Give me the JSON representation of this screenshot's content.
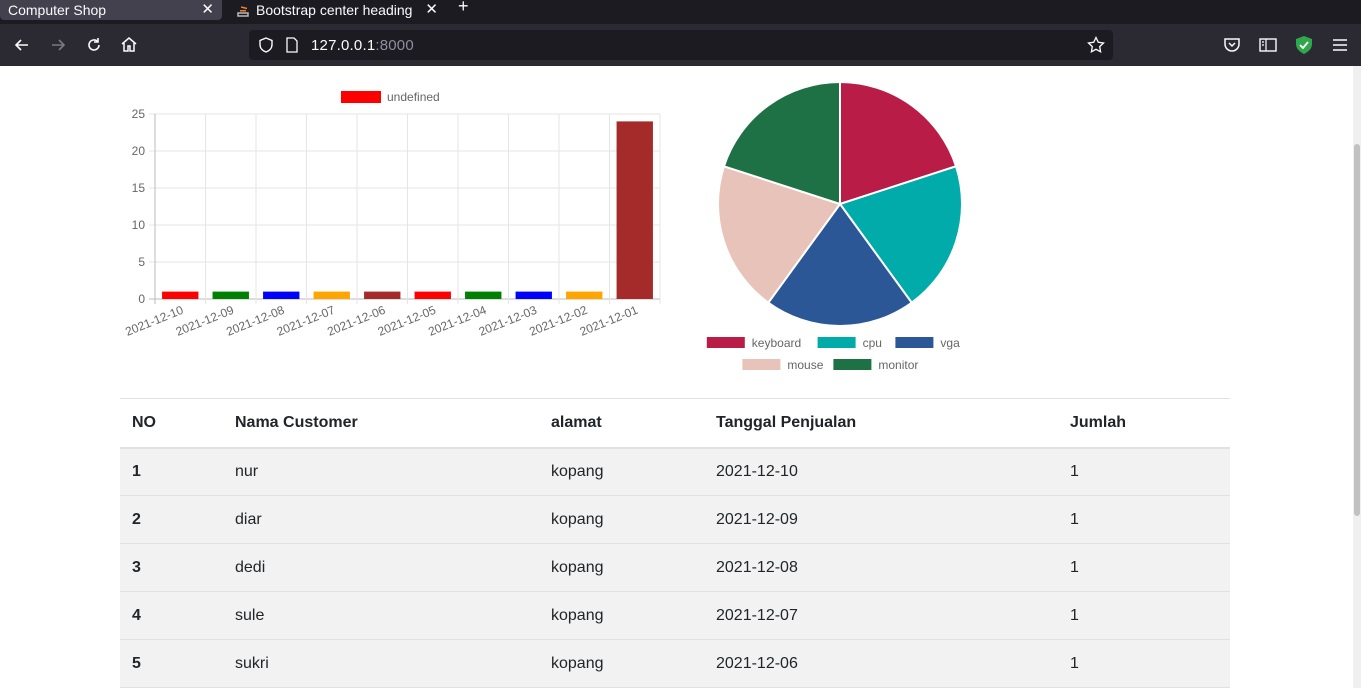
{
  "browser": {
    "tabs": [
      {
        "title": "Computer Shop",
        "active": true
      },
      {
        "title": "Bootstrap center heading",
        "active": false
      }
    ],
    "url_host": "127.0.0.1",
    "url_port": ":8000"
  },
  "chart_data": [
    {
      "type": "bar",
      "legend": [
        "undefined"
      ],
      "categories": [
        "2021-12-10",
        "2021-12-09",
        "2021-12-08",
        "2021-12-07",
        "2021-12-06",
        "2021-12-05",
        "2021-12-04",
        "2021-12-03",
        "2021-12-02",
        "2021-12-01"
      ],
      "values": [
        1,
        1,
        1,
        1,
        1,
        1,
        1,
        1,
        1,
        24
      ],
      "colors": [
        "#ff0000",
        "#008000",
        "#0000ff",
        "#ffa500",
        "#a52a2a",
        "#ff0000",
        "#008000",
        "#0000ff",
        "#ffa500",
        "#a52a2a"
      ],
      "yticks": [
        0,
        5,
        10,
        15,
        20,
        25
      ],
      "ylim": [
        0,
        25
      ],
      "grid": true,
      "legend_position": "top"
    },
    {
      "type": "pie",
      "labels": [
        "keyboard",
        "cpu",
        "vga",
        "mouse",
        "monitor"
      ],
      "values": [
        1,
        1,
        1,
        1,
        1
      ],
      "colors": [
        "#b91d47",
        "#00aba9",
        "#2b5797",
        "#e8c3b9",
        "#1e7145"
      ],
      "legend_position": "bottom"
    }
  ],
  "table": {
    "headers": [
      "NO",
      "Nama Customer",
      "alamat",
      "Tanggal Penjualan",
      "Jumlah"
    ],
    "rows": [
      [
        "1",
        "nur",
        "kopang",
        "2021-12-10",
        "1"
      ],
      [
        "2",
        "diar",
        "kopang",
        "2021-12-09",
        "1"
      ],
      [
        "3",
        "dedi",
        "kopang",
        "2021-12-08",
        "1"
      ],
      [
        "4",
        "sule",
        "kopang",
        "2021-12-07",
        "1"
      ],
      [
        "5",
        "sukri",
        "kopang",
        "2021-12-06",
        "1"
      ]
    ]
  }
}
